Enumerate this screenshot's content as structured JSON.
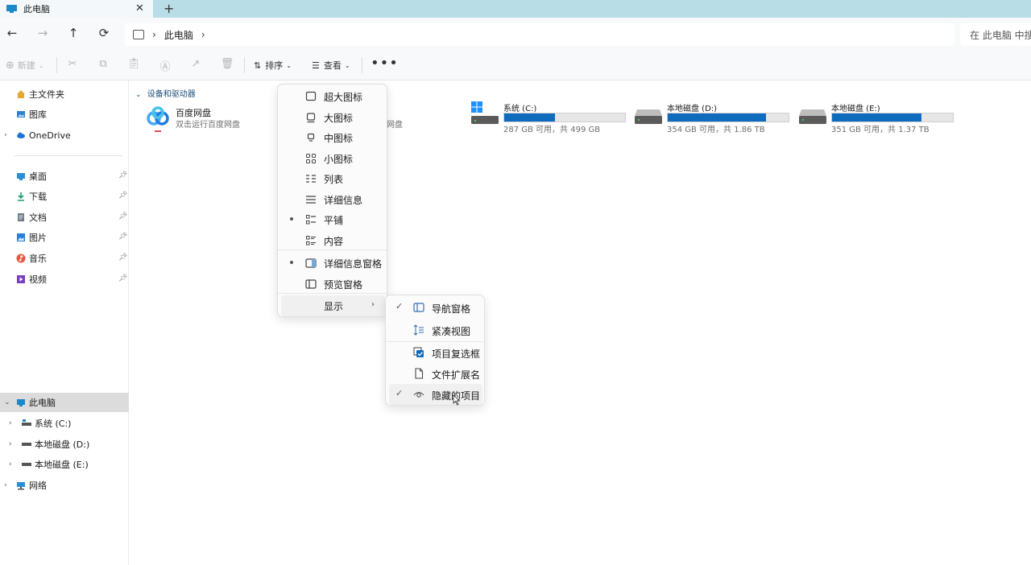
{
  "tab": {
    "title": "此电脑",
    "close": "✕",
    "new_tab": "+"
  },
  "nav": {
    "back": "←",
    "forward": "→",
    "up": "↑",
    "refresh": "⟳"
  },
  "address": {
    "sep1": "›",
    "crumb": "此电脑",
    "sep2": "›"
  },
  "search": {
    "placeholder": "在 此电脑 中搜索"
  },
  "commandbar": {
    "new_label": "新建",
    "sort_label": "排序",
    "view_label": "查看",
    "more": "•••",
    "icons": [
      "cut-icon",
      "copy-icon",
      "paste-icon",
      "rename-icon",
      "share-icon",
      "delete-icon"
    ]
  },
  "sidebar": {
    "top": [
      {
        "label": "主文件夹",
        "icon": "home-icon"
      },
      {
        "label": "图库",
        "icon": "gallery-icon"
      },
      {
        "label": "OneDrive",
        "icon": "cloud-icon"
      }
    ],
    "quick": [
      {
        "label": "桌面",
        "icon": "desktop-icon"
      },
      {
        "label": "下载",
        "icon": "download-icon"
      },
      {
        "label": "文档",
        "icon": "document-icon"
      },
      {
        "label": "图片",
        "icon": "picture-icon"
      },
      {
        "label": "音乐",
        "icon": "music-icon"
      },
      {
        "label": "视频",
        "icon": "video-icon"
      }
    ],
    "tree": [
      {
        "label": "此电脑",
        "icon": "pc-icon"
      },
      {
        "label": "系统 (C:)",
        "icon": "drive-icon"
      },
      {
        "label": "本地磁盘 (D:)",
        "icon": "drive-icon"
      },
      {
        "label": "本地磁盘 (E:)",
        "icon": "drive-icon"
      },
      {
        "label": "网络",
        "icon": "network-icon"
      }
    ]
  },
  "content": {
    "group_title": "设备和驱动器",
    "baidu": {
      "name": "百度网盘",
      "subtitle": "双击运行百度网盘",
      "subtitle_partial": "网盘"
    },
    "drives": [
      {
        "name": "系统 (C:)",
        "capacity": "287 GB 可用，共 499 GB",
        "used_fraction": 0.42
      },
      {
        "name": "本地磁盘 (D:)",
        "capacity": "354 GB 可用，共 1.86 TB",
        "used_fraction": 0.81
      },
      {
        "name": "本地磁盘 (E:)",
        "capacity": "351 GB 可用，共 1.37 TB",
        "used_fraction": 0.74
      }
    ]
  },
  "view_menu": {
    "items": [
      {
        "label": "超大图标",
        "icon": "extra-large-icons-icon",
        "selected": false
      },
      {
        "label": "大图标",
        "icon": "large-icons-icon",
        "selected": false
      },
      {
        "label": "中图标",
        "icon": "medium-icons-icon",
        "selected": false
      },
      {
        "label": "小图标",
        "icon": "small-icons-icon",
        "selected": false
      },
      {
        "label": "列表",
        "icon": "list-icon",
        "selected": false
      },
      {
        "label": "详细信息",
        "icon": "details-icon",
        "selected": false
      },
      {
        "label": "平铺",
        "icon": "tiles-icon",
        "selected": true
      },
      {
        "label": "内容",
        "icon": "content-icon",
        "selected": false
      },
      {
        "label": "详细信息窗格",
        "icon": "details-pane-icon",
        "selected": true
      },
      {
        "label": "预览窗格",
        "icon": "preview-pane-icon",
        "selected": false
      }
    ],
    "show_label": "显示",
    "arrow": "›"
  },
  "show_submenu": {
    "items": [
      {
        "label": "导航窗格",
        "checked": true,
        "icon": "navigation-pane-icon"
      },
      {
        "label": "紧凑视图",
        "checked": false,
        "icon": "compact-view-icon"
      },
      {
        "label": "项目复选框",
        "checked": false,
        "icon": "item-checkbox-icon"
      },
      {
        "label": "文件扩展名",
        "checked": false,
        "icon": "file-extension-icon"
      },
      {
        "label": "隐藏的项目",
        "checked": true,
        "icon": "hidden-items-icon"
      }
    ],
    "check_mark": "✓"
  },
  "colors": {
    "accent": "#0f6cbd",
    "tabbar": "#b8dde6",
    "selected_bg": "#dcdcdc"
  }
}
